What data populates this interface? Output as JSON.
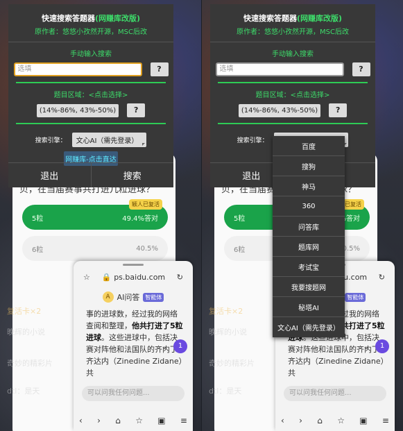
{
  "panel": {
    "title_main": "快速搜索答题器",
    "title_accent": "(网赚库改版)",
    "author": "原作者：悠悠小孜然开源，MSC后改",
    "manual_label": "手动输入搜索",
    "input_placeholder": "选填",
    "question_btn": "?",
    "area_label": "题目区域：<点击选择>",
    "range_value": "(14%-86%, 43%-50%)",
    "engine_label": "搜索引擎：",
    "engine_value": "文心AI（需先登录）",
    "link_btn": "网赚库-点击直达",
    "exit_btn": "退出",
    "search_btn": "搜索"
  },
  "dropdown": {
    "items": [
      "百度",
      "搜狗",
      "神马",
      "360",
      "问答库",
      "题库网",
      "考试宝",
      "我要搜题网",
      "秘塔AI",
      "文心AI（需先登录）"
    ]
  },
  "quiz": {
    "question": "贝，在当届赛事共打进几粒进球？",
    "opt1": "5粒",
    "opt1_pct": "49.4%答对",
    "opt1_badge": "颖人已复活",
    "opt2": "6粒",
    "opt2_pct": "40.5%",
    "revive": "复活卡×2"
  },
  "browser": {
    "url": "ps.baidu.com",
    "ai_label": "AI问答",
    "ai_tag": "智能体",
    "answer_1": "事的进球数，经过我的网络查阅和整理，",
    "answer_bold": "他共打进了5粒进球",
    "answer_2": "。这些进球中，包括决赛对阵他和法国队的齐内丁·齐达内（Zinedine Zidane）共",
    "ask_placeholder": "可以问我任何问题...",
    "chat_num": "1"
  },
  "bg": {
    "line1": "晚辉的小说",
    "line2": "奇妙的精彩片",
    "line3": "dtl：是天"
  }
}
